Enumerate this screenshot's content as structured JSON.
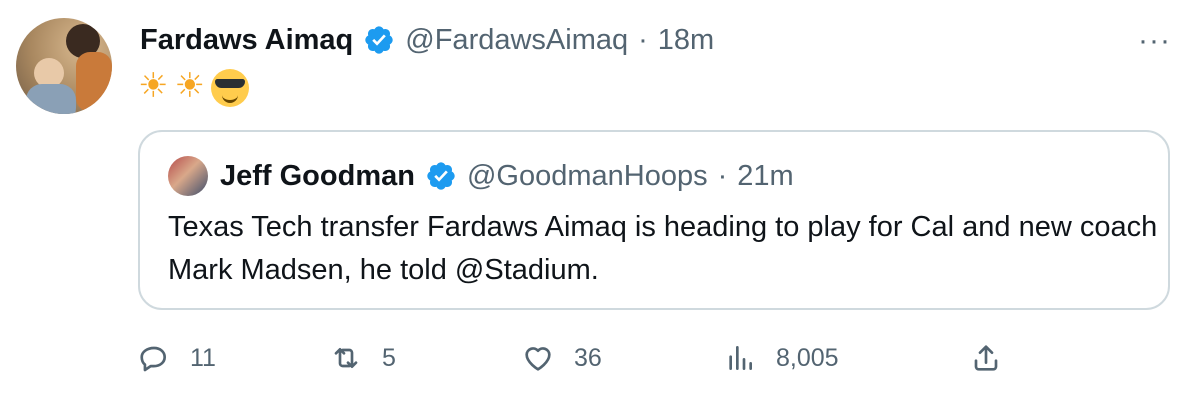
{
  "tweet": {
    "author_name": "Fardaws Aimaq",
    "author_handle": "@FardawsAimaq",
    "separator": "·",
    "time": "18m",
    "emojis": [
      {
        "icon": "sun-icon",
        "glyph": "☀"
      },
      {
        "icon": "sun-icon",
        "glyph": "☀"
      },
      {
        "icon": "smiling-face-with-sunglasses-icon",
        "glyph": ""
      }
    ],
    "more_label": "···"
  },
  "quoted_tweet": {
    "author_name": "Jeff Goodman",
    "author_handle": "@GoodmanHoops",
    "separator": "·",
    "time": "21m",
    "text": "Texas Tech transfer Fardaws Aimaq is heading to play for Cal and new coach Mark Madsen, he told @Stadium."
  },
  "actions": {
    "reply": {
      "icon": "reply-icon",
      "count": "11"
    },
    "retweet": {
      "icon": "retweet-icon",
      "count": "5"
    },
    "like": {
      "icon": "heart-icon",
      "count": "36"
    },
    "views": {
      "icon": "views-icon",
      "count": "8,005"
    },
    "share": {
      "icon": "share-icon",
      "count": ""
    }
  },
  "colors": {
    "verified": "#1d9bf0",
    "secondary_text": "#536471",
    "border": "#cfd9de"
  }
}
